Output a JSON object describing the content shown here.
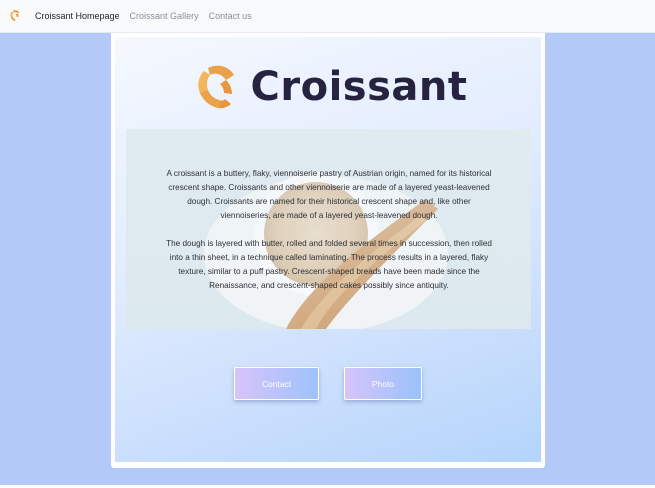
{
  "nav": {
    "logo": "croissant-icon",
    "links": [
      {
        "label": "Croissant Homepage",
        "active": true
      },
      {
        "label": "Croissant Gallery",
        "active": false
      },
      {
        "label": "Contact us",
        "active": false
      }
    ]
  },
  "hero": {
    "icon": "croissant-icon",
    "title": "Croissant"
  },
  "content": {
    "paragraphs": [
      "A croissant is a buttery, flaky, viennoiserie pastry of Austrian origin, named for its historical crescent shape. Croissants and other viennoiserie are made of a layered yeast-leavened dough. Croissants are named for their historical crescent shape and, like other viennoiseries, are made of a layered yeast-leavened dough.",
      "The dough is layered with butter, rolled and folded several times in succession, then rolled into a thin sheet, in a technique called laminating. The process results in a layered, flaky texture, similar to a puff pastry. Crescent-shaped breads have been made since the Renaissance, and crescent-shaped cakes possibly since antiquity."
    ]
  },
  "buttons": {
    "contact": "Contact",
    "photo": "Photo"
  },
  "colors": {
    "background": "#b3c9f7",
    "title": "#25233f",
    "croissant": "#eba14a",
    "button_gradient_start": "#d7c4fb",
    "button_gradient_end": "#9fc1fb"
  }
}
